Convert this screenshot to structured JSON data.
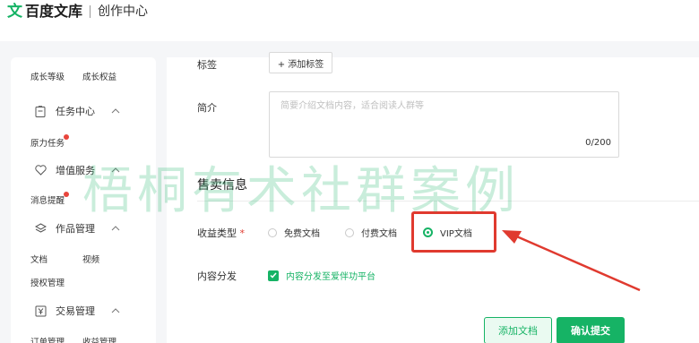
{
  "header": {
    "logo_mark": "文",
    "brand": "百度文库",
    "section": "创作中心"
  },
  "sidebar": {
    "growth_level": "成长等级",
    "growth_rights": "成长权益",
    "task_center": "任务中心",
    "task_sub": "原力任务",
    "value_services": "增值服务",
    "value_sub": "消息提醒",
    "works_mgmt": "作品管理",
    "works_doc": "文档",
    "works_video": "视频",
    "works_auth": "授权管理",
    "trade_mgmt": "交易管理",
    "trade_orders": "订单管理",
    "trade_income": "收益管理"
  },
  "form": {
    "tags_label": "标签",
    "add_tag_button": "+ 添加标签",
    "intro_label": "简介",
    "intro_placeholder": "简要介绍文档内容，适合阅读人群等",
    "intro_counter": "0/200",
    "sale_section_title": "售卖信息",
    "income_type_label": "收益类型",
    "required_mark": "*",
    "options": [
      "免费文档",
      "付费文档",
      "VIP文档"
    ],
    "selected_option": "VIP文档",
    "distribution_label": "内容分发",
    "distribution_checkbox": "内容分发至爱伴功平台",
    "add_doc_button": "添加文档",
    "confirm_button": "确认提交"
  },
  "watermark": "梧桐有术社群案例",
  "colors": {
    "brand_green": "#16b365",
    "highlight_red": "#e03a2f"
  }
}
